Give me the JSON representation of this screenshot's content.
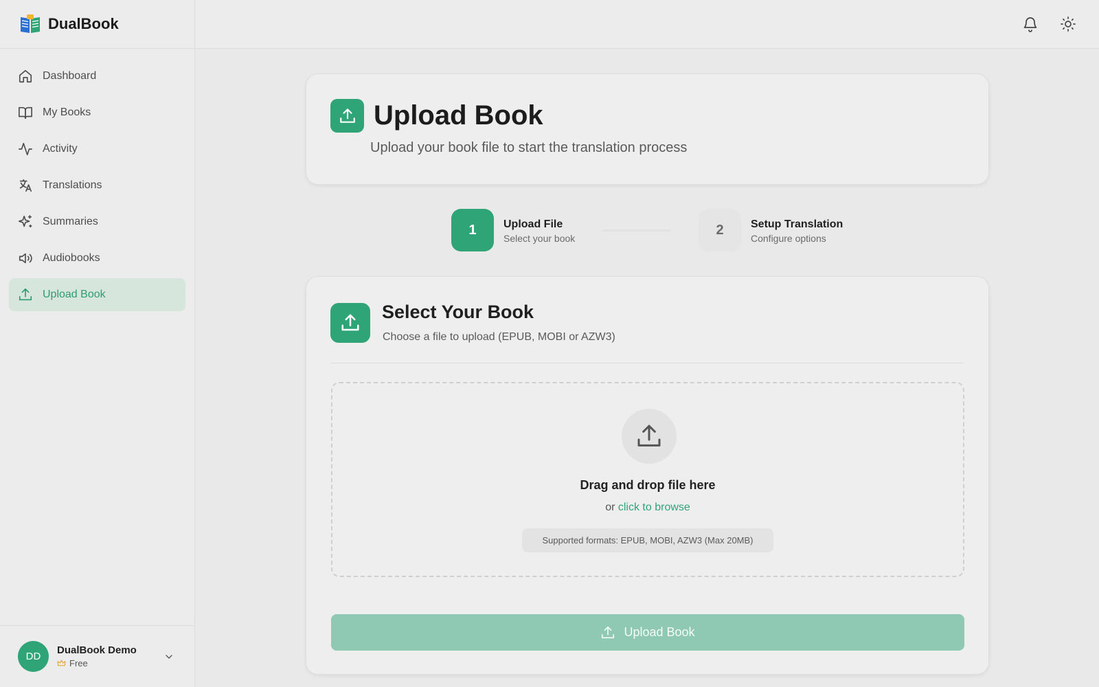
{
  "app": {
    "name": "DualBook"
  },
  "sidebar": {
    "items": [
      {
        "label": "Dashboard",
        "icon": "home-icon"
      },
      {
        "label": "My Books",
        "icon": "book-open-icon"
      },
      {
        "label": "Activity",
        "icon": "activity-icon"
      },
      {
        "label": "Translations",
        "icon": "translate-icon"
      },
      {
        "label": "Summaries",
        "icon": "sparkles-icon"
      },
      {
        "label": "Audiobooks",
        "icon": "speaker-icon"
      },
      {
        "label": "Upload Book",
        "icon": "upload-icon",
        "active": true
      }
    ],
    "user": {
      "initials": "DD",
      "name": "DualBook Demo",
      "plan": "Free"
    }
  },
  "topbar": {
    "icons": [
      "bell-icon",
      "sun-icon"
    ]
  },
  "header": {
    "title": "Upload Book",
    "subtitle": "Upload your book file to start the translation process"
  },
  "stepper": {
    "steps": [
      {
        "number": "1",
        "title": "Upload File",
        "subtitle": "Select your book",
        "active": true
      },
      {
        "number": "2",
        "title": "Setup Translation",
        "subtitle": "Configure options",
        "active": false
      }
    ]
  },
  "select": {
    "title": "Select Your Book",
    "subtitle": "Choose a file to upload (EPUB, MOBI or AZW3)",
    "dropzone": {
      "title": "Drag and drop file here",
      "or_text": "or",
      "browse_link": "click to browse",
      "formats": "Supported formats: EPUB, MOBI, AZW3 (Max 20MB)"
    },
    "button_label": "Upload Book"
  },
  "colors": {
    "accent": "#2fa477",
    "active_nav_bg": "#d6e6dd",
    "button_disabled": "#8fc9b3"
  }
}
